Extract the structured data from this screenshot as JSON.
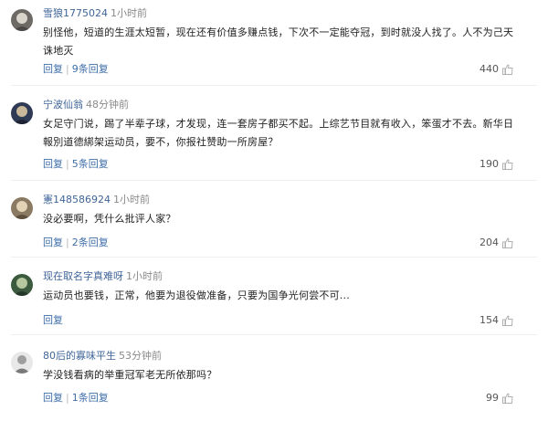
{
  "comments": [
    {
      "author": "雪狼1775024",
      "time": "1小时前",
      "text": "别怪他，短道的生涯太短暂，现在还有价值多赚点钱，下次不一定能夺冠，到时就没人找了。人不为己天诛地灭",
      "reply_label": "回复",
      "replies_label": "9条回复",
      "likes": "440"
    },
    {
      "author": "宁波仙翁",
      "time": "48分钟前",
      "text": "女足守门说，踢了半辈子球，才发现，连一套房子都买不起。上综艺节目就有收入，笨蛋才不去。新华日報別道德綁架运动员，要不，你报社赞助一所房屋？",
      "reply_label": "回复",
      "replies_label": "5条回复",
      "likes": "190"
    },
    {
      "author": "憲148586924",
      "time": "1小时前",
      "text": "没必要啊，凭什么批评人家？",
      "reply_label": "回复",
      "replies_label": "2条回复",
      "likes": "204"
    },
    {
      "author": "现在取名字真难呀",
      "time": "1小时前",
      "text": "运动员也要钱，正常，他要为退役做准备，只要为国争光何尝不可...",
      "reply_label": "回复",
      "replies_label": "",
      "likes": "154"
    },
    {
      "author": "80后的寡味平生",
      "time": "53分钟前",
      "text": "学没钱看病的举重冠军老无所依那吗？",
      "reply_label": "回复",
      "replies_label": "1条回复",
      "likes": "99"
    }
  ],
  "icons": {
    "like": "thumbs-up-icon",
    "avatar": "user-avatar"
  },
  "colors": {
    "author": "#406599",
    "action": "#3f6ea8",
    "text": "#222222",
    "meta": "#8a8a8a"
  }
}
